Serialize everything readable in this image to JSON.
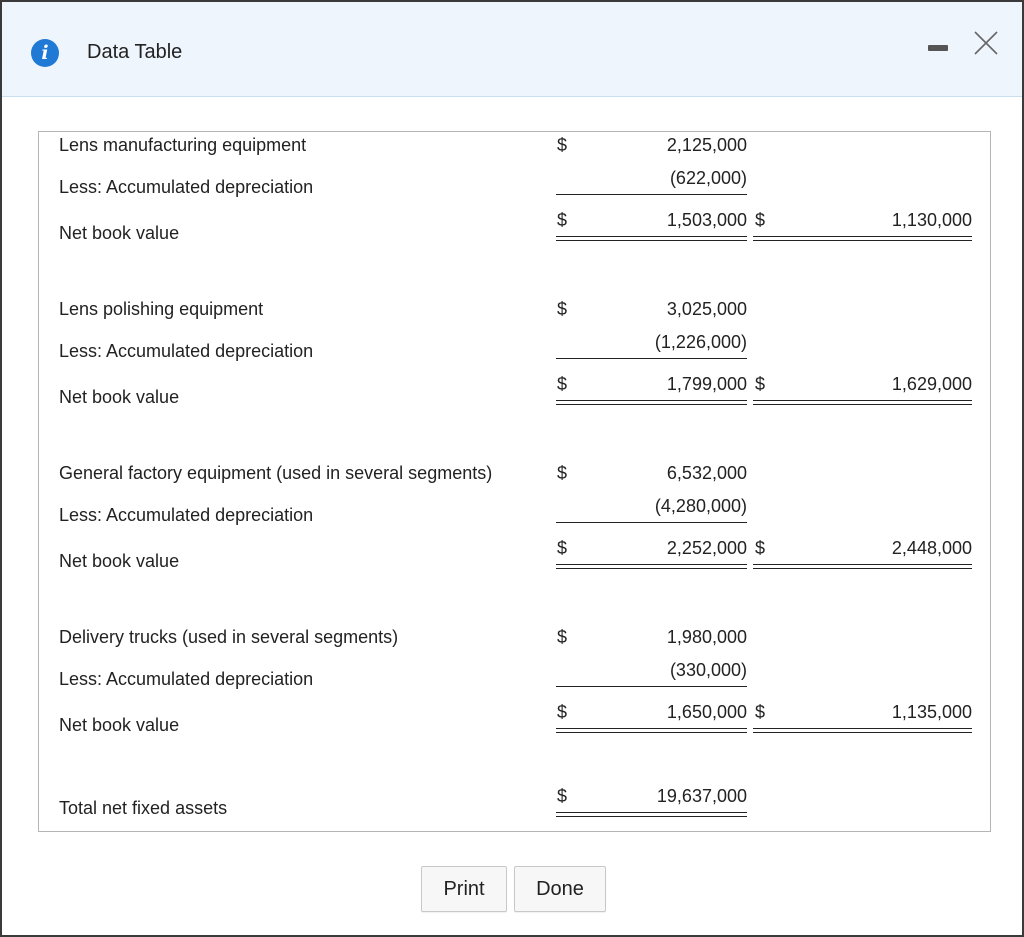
{
  "dialog": {
    "title": "Data Table",
    "info_icon": "i",
    "icons": {
      "info": "info-icon",
      "minimize": "minimize-icon",
      "close": "close-icon"
    },
    "accent_color": "#1f7ad6"
  },
  "sections": [
    {
      "asset": "Lens manufacturing equipment",
      "cost_dollar": "$",
      "cost": "2,125,000",
      "less_label": "Less: Accumulated depreciation",
      "accumulated": "(622,000)",
      "net_label": "Net book value",
      "net_dollar": "$",
      "net_value": "1,503,000",
      "prior_dollar": "$",
      "prior_value": "1,130,000"
    },
    {
      "asset": "Lens polishing equipment",
      "cost_dollar": "$",
      "cost": "3,025,000",
      "less_label": "Less: Accumulated depreciation",
      "accumulated": "(1,226,000)",
      "net_label": "Net book value",
      "net_dollar": "$",
      "net_value": "1,799,000",
      "prior_dollar": "$",
      "prior_value": "1,629,000"
    },
    {
      "asset": "General factory equipment (used in several segments)",
      "cost_dollar": "$",
      "cost": "6,532,000",
      "less_label": "Less: Accumulated depreciation",
      "accumulated": "(4,280,000)",
      "net_label": "Net book value",
      "net_dollar": "$",
      "net_value": "2,252,000",
      "prior_dollar": "$",
      "prior_value": "2,448,000"
    },
    {
      "asset": "Delivery trucks (used in several segments)",
      "cost_dollar": "$",
      "cost": "1,980,000",
      "less_label": "Less: Accumulated depreciation",
      "accumulated": "(330,000)",
      "net_label": "Net book value",
      "net_dollar": "$",
      "net_value": "1,650,000",
      "prior_dollar": "$",
      "prior_value": "1,135,000"
    }
  ],
  "total": {
    "label": "Total net fixed assets",
    "dollar": "$",
    "value": "19,637,000"
  },
  "buttons": {
    "print": "Print",
    "done": "Done"
  }
}
